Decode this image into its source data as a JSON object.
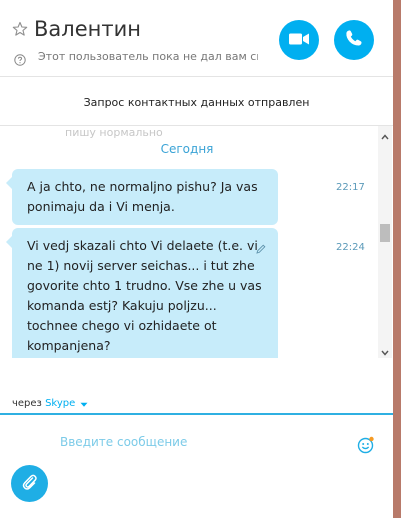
{
  "header": {
    "contact_name": "Валентин",
    "status": "Этот пользователь пока не дал вам св..."
  },
  "notice": "Запрос контактных данных отправлен",
  "chat": {
    "previous_fragment": "пишу нормально",
    "day_label": "Сегодня",
    "messages": [
      {
        "text": "A ja chto, ne normaljno pishu? Ja vas ponimaju da i Vi menja.",
        "time": "22:17"
      },
      {
        "text": "Vi vedj skazali chto Vi delaete (t.e. vi ne 1) novij server seichas... i tut zhe govorite chto 1 trudno. Vse zhe u vas komanda estj? Kakuju poljzu... tochnee chego vi ozhidaete ot kompanjena?",
        "time": "22:24"
      }
    ]
  },
  "compose": {
    "via_prefix": "через",
    "via_link": "Skype",
    "placeholder": "Введите сообщение"
  },
  "colors": {
    "accent": "#00aff0",
    "bubble": "#c7ecfa",
    "time": "#5b9ab9",
    "window_frame": "#b87a6a"
  },
  "icons": {
    "favorite": "star-icon",
    "help": "question-icon",
    "video": "video-camera-icon",
    "call": "phone-icon",
    "edit": "pencil-icon",
    "emoji": "smiley-icon",
    "attach": "paperclip-icon"
  }
}
